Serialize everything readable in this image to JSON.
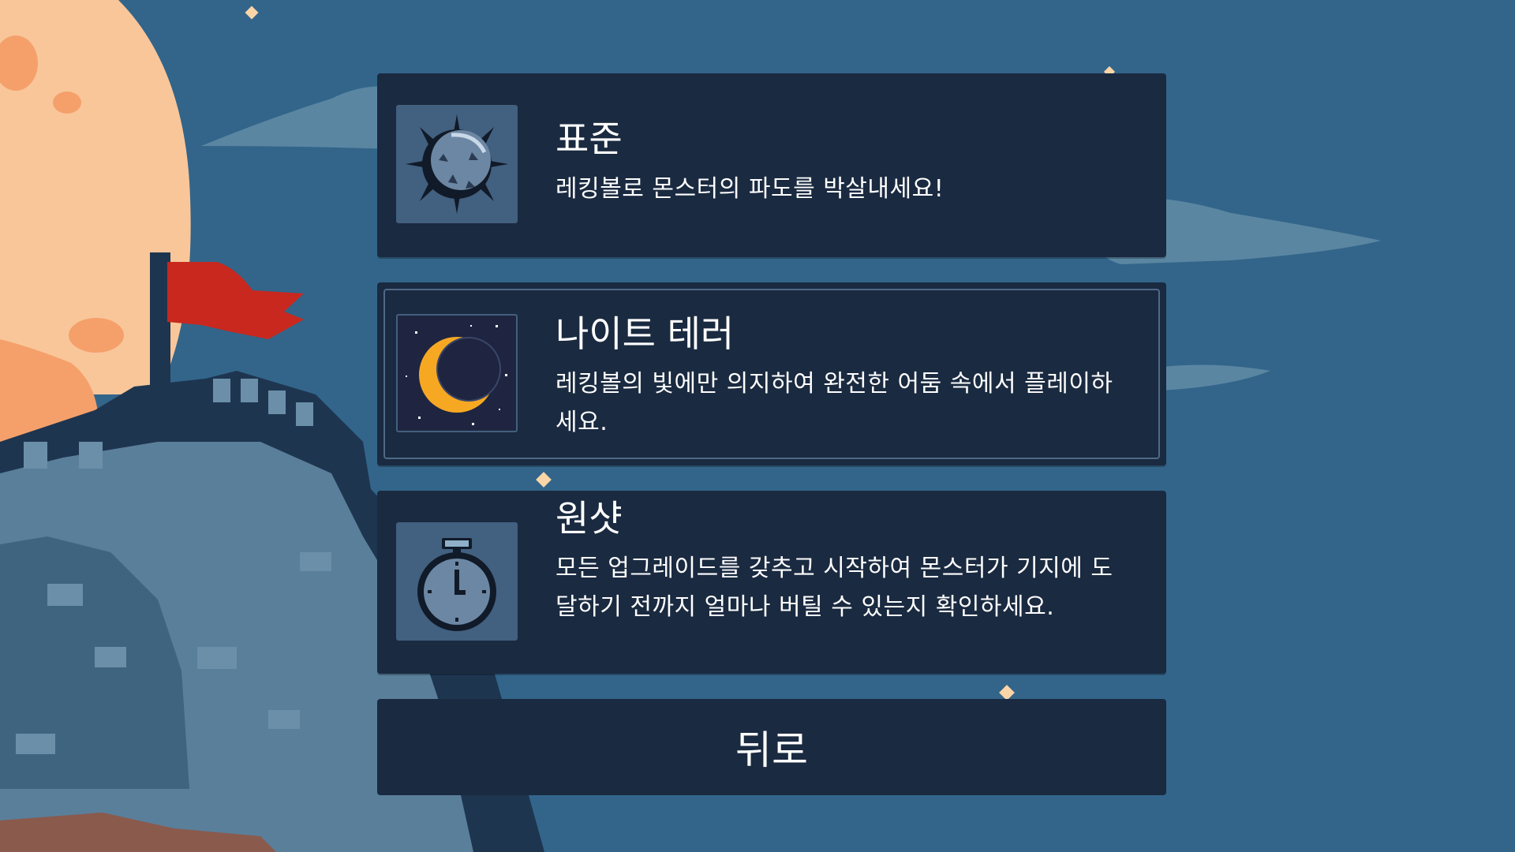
{
  "colors": {
    "sky": "#33658a",
    "panel": "#1a2a40",
    "icon_tile": "#42607f",
    "moon_big": "#f9c69a",
    "flag": "#c8281e",
    "crescent": "#f7a823",
    "text": "#ffffff"
  },
  "modes": [
    {
      "title": "표준",
      "description": "레킹볼로 몬스터의 파도를 박살내세요!",
      "icon": "wrecking-ball-icon"
    },
    {
      "title": "나이트 테러",
      "description": "레킹볼의 빛에만 의지하여 완전한 어둠 속에서 플레이하세요.",
      "icon": "crescent-moon-icon",
      "selected": true
    },
    {
      "title": "원샷",
      "description": "모든 업그레이드를 갖추고 시작하여 몬스터가 기지에 도달하기 전까지 얼마나 버틸 수 있는지 확인하세요.",
      "icon": "stopwatch-icon"
    }
  ],
  "back_label": "뒤로"
}
